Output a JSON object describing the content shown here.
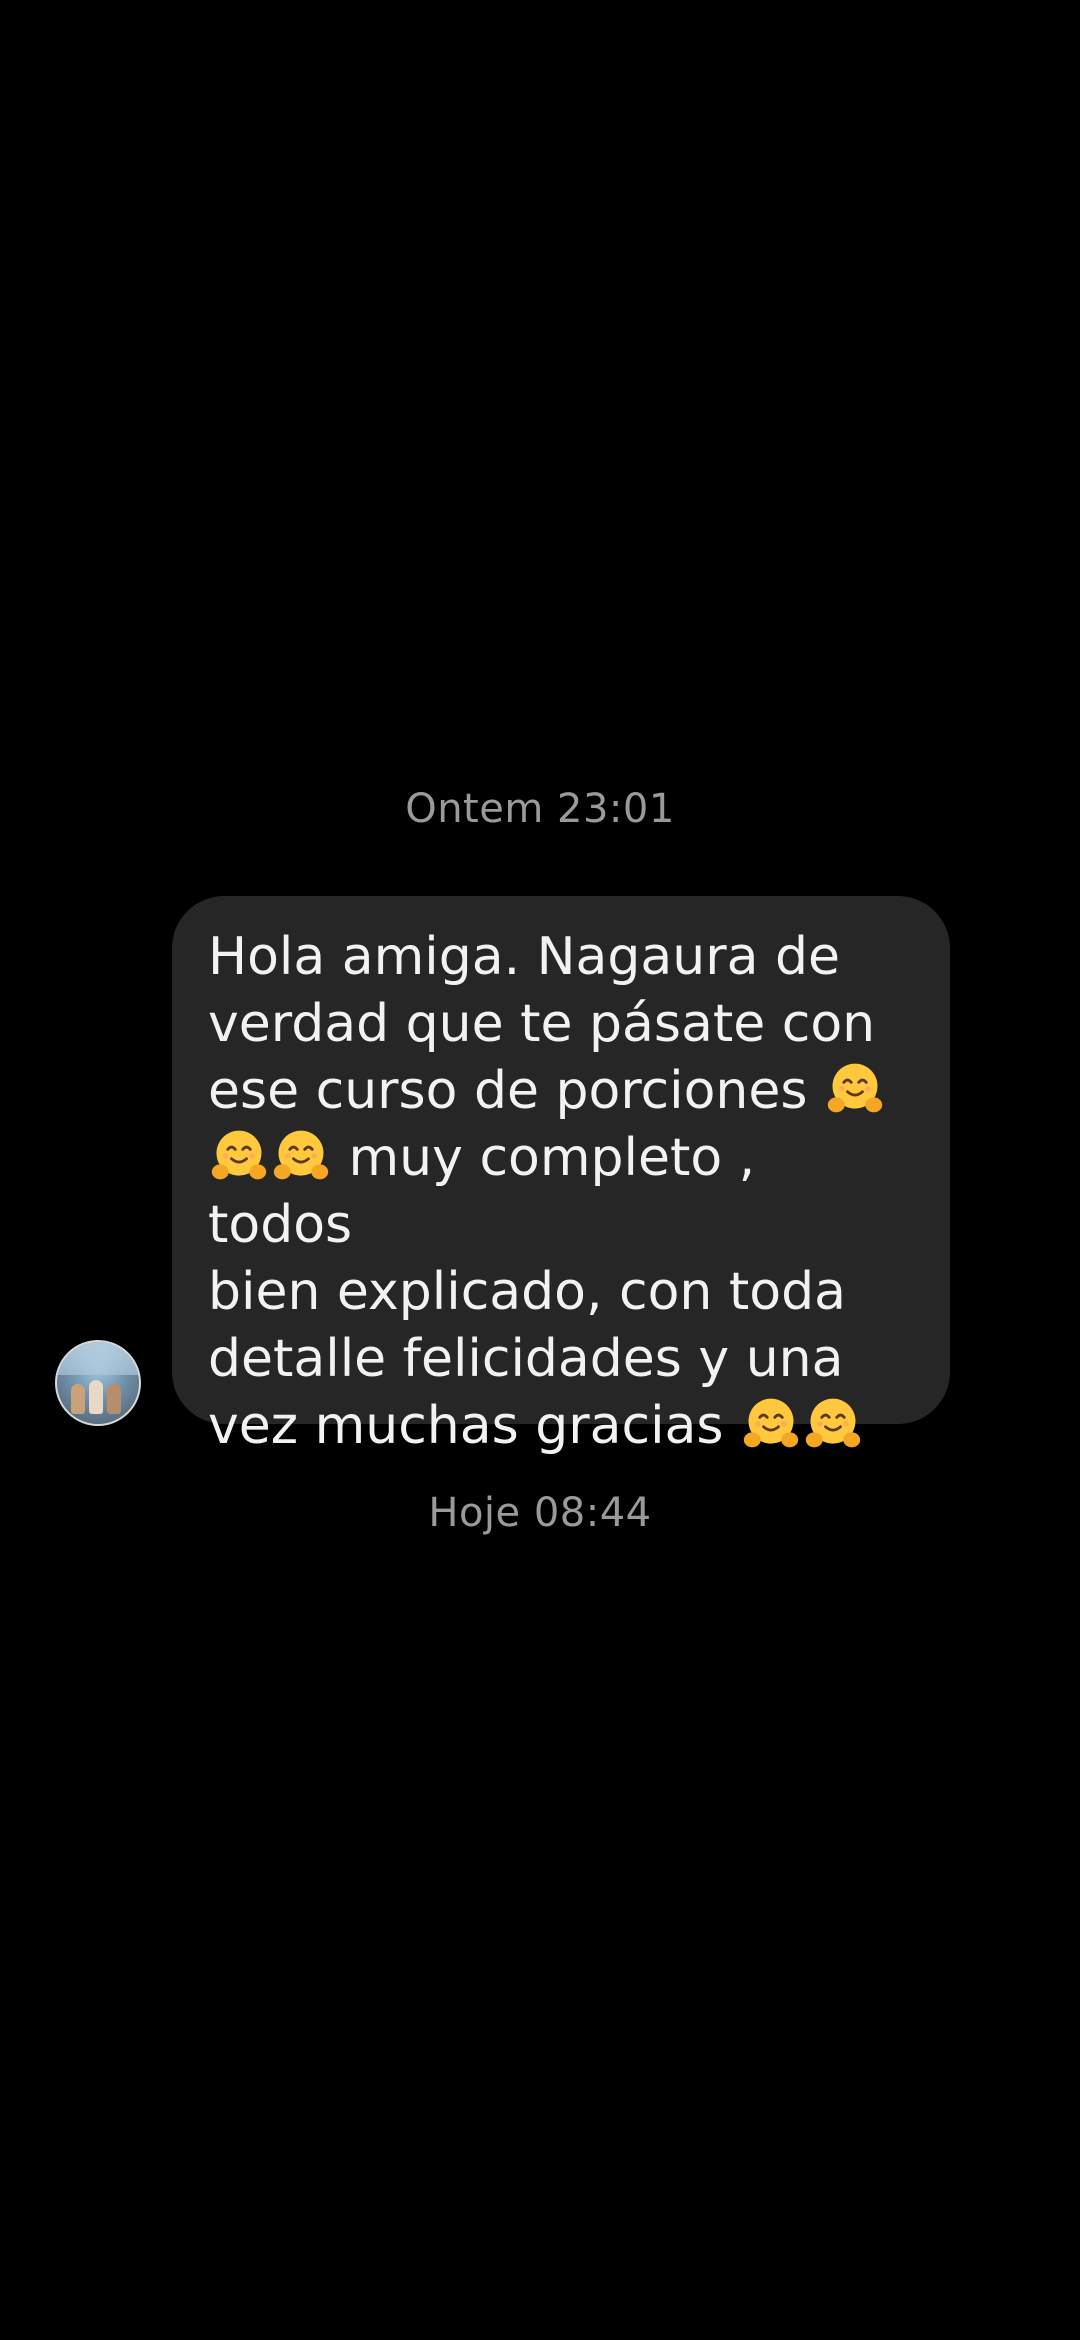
{
  "conversation": {
    "earlier_timestamp": "Ontem 23:01",
    "later_timestamp": "Hoje 08:44"
  },
  "message": {
    "lines": [
      "Hola amiga. Nagaura de",
      "verdad que te pásate con",
      "ese curso de porciones",
      "muy completo , todos",
      "bien explicado, con toda",
      "detalle felicidades y una",
      "vez muchas gracias"
    ],
    "emoji_name": "hugging-face-emoji",
    "bubble_color": "#262626",
    "text_color": "#f2f2f2"
  },
  "sender": {
    "avatar_icon": "contact-avatar"
  },
  "colors": {
    "background": "#000000",
    "timestamp": "#9a9a9a"
  }
}
